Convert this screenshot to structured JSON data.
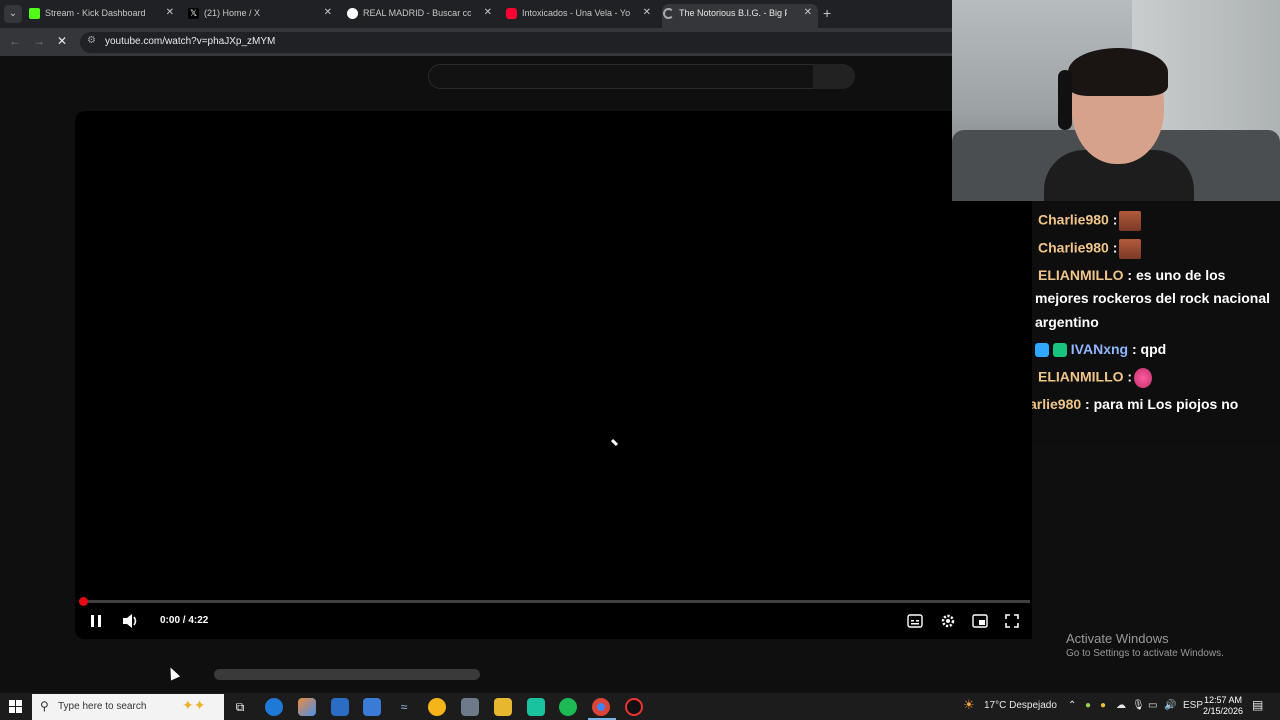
{
  "browser": {
    "tabs": [
      {
        "title": "Stream - Kick Dashboard",
        "icon": "kick-icon",
        "active": false
      },
      {
        "title": "(21) Home / X",
        "icon": "x-icon",
        "active": false
      },
      {
        "title": "REAL MADRID - Buscar con Go",
        "icon": "google-icon",
        "active": false
      },
      {
        "title": "Intoxicados - Una Vela - YouTu",
        "icon": "youtube-icon",
        "active": false
      },
      {
        "title": "The Notorious B.I.G. - Big Popp",
        "icon": "loading-icon",
        "active": true
      }
    ],
    "url": "youtube.com/watch?v=phaJXp_zMYM"
  },
  "player": {
    "time": "0:00 / 4:22",
    "progress": 0.0
  },
  "chat": {
    "messages": [
      {
        "user": "Charlie980",
        "sep": " :",
        "text": "",
        "emote": "face-emote"
      },
      {
        "user": "Charlie980",
        "sep": " :",
        "text": "",
        "emote": "face-emote"
      },
      {
        "user": "ELIANMILLO",
        "sep": " :",
        "text": " es uno de los"
      },
      {
        "user": "",
        "sep": "",
        "text": "mejores rockeros del rock nacional"
      },
      {
        "user": "",
        "sep": "",
        "text": "argentino"
      },
      {
        "user": "IVANxng",
        "sep": " :",
        "text": " qpd",
        "badges": true
      },
      {
        "user": "ELIANMILLO",
        "sep": " :",
        "text": "",
        "emote": "heart-emote"
      },
      {
        "user": "arlie980",
        "sep": " :",
        "text": " para mi Los piojos no"
      }
    ]
  },
  "watermark": {
    "line1": "Activate Windows",
    "line2": "Go to Settings to activate Windows."
  },
  "taskbar": {
    "search_placeholder": "Type here to search",
    "weather": "17°C  Despejado",
    "lang": "ESP",
    "time": "12:57 AM",
    "date": "2/15/2026"
  }
}
